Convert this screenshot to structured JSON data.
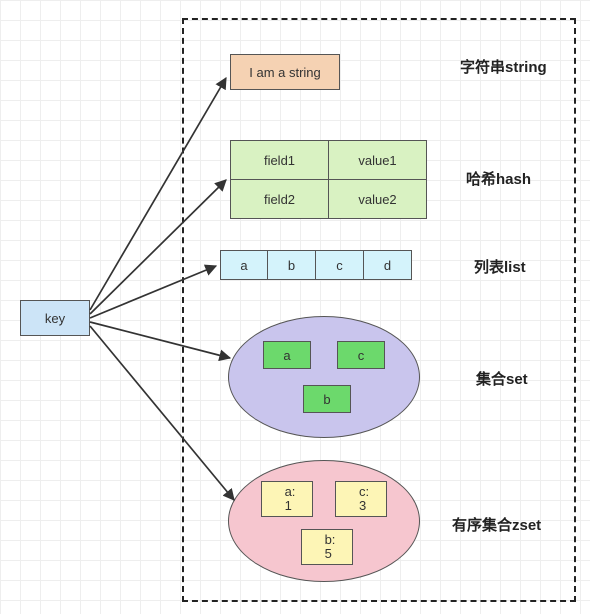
{
  "key": "key",
  "types": {
    "string": {
      "label": "字符串string",
      "value": "I am a string"
    },
    "hash": {
      "label": "哈希hash",
      "rows": [
        [
          "field1",
          "value1"
        ],
        [
          "field2",
          "value2"
        ]
      ]
    },
    "list": {
      "label": "列表list",
      "items": [
        "a",
        "b",
        "c",
        "d"
      ]
    },
    "set": {
      "label": "集合set",
      "members": [
        "a",
        "c",
        "b"
      ]
    },
    "zset": {
      "label": "有序集合zset",
      "members": [
        {
          "m": "a",
          "s": "1"
        },
        {
          "m": "c",
          "s": "3"
        },
        {
          "m": "b",
          "s": "5"
        }
      ]
    }
  }
}
